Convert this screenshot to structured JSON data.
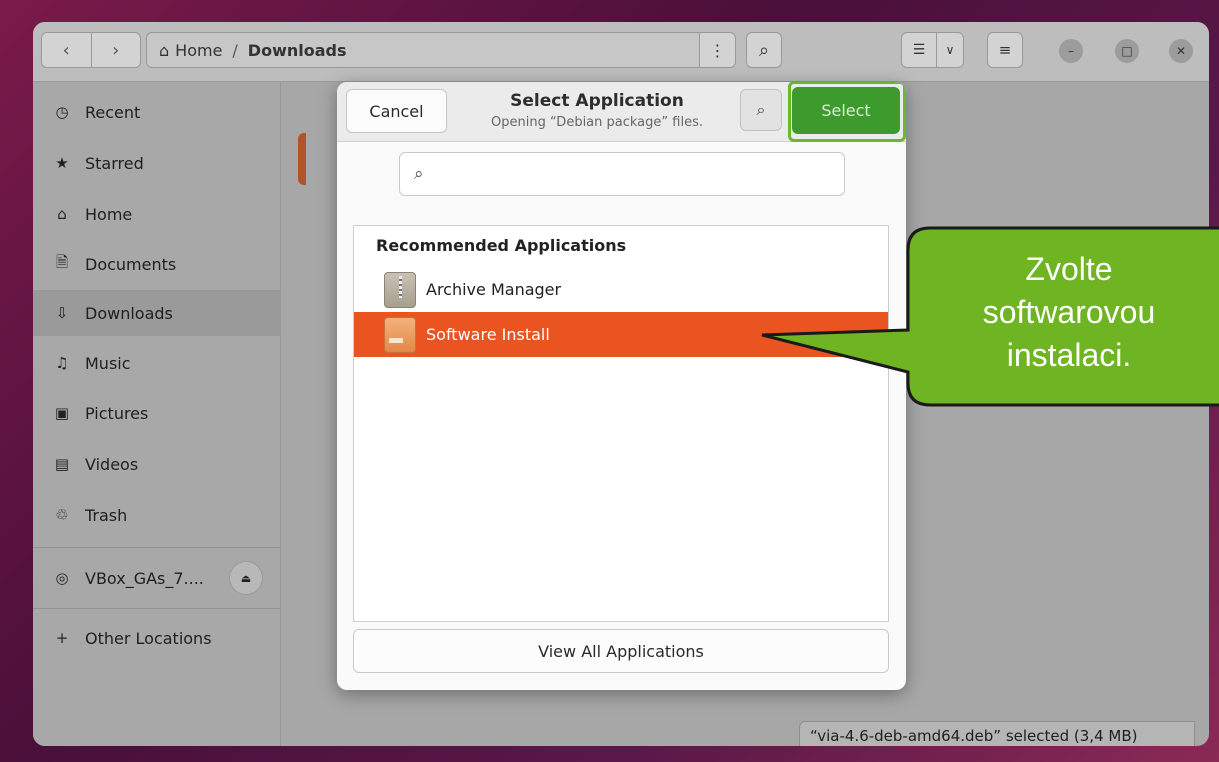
{
  "files_window": {
    "path": {
      "home_label": "Home",
      "separator": "/",
      "current": "Downloads"
    },
    "sidebar": {
      "items": [
        {
          "icon": "clock-icon",
          "label": "Recent"
        },
        {
          "icon": "star-icon",
          "label": "Starred"
        },
        {
          "icon": "home-icon",
          "label": "Home"
        },
        {
          "icon": "document-icon",
          "label": "Documents"
        },
        {
          "icon": "download-icon",
          "label": "Downloads",
          "active": true
        },
        {
          "icon": "music-icon",
          "label": "Music"
        },
        {
          "icon": "picture-icon",
          "label": "Pictures"
        },
        {
          "icon": "video-icon",
          "label": "Videos"
        },
        {
          "icon": "trash-icon",
          "label": "Trash"
        }
      ],
      "drive": {
        "icon": "disc-icon",
        "label": "VBox_GAs_7....",
        "eject_icon": "eject-icon"
      },
      "other": {
        "icon": "plus-icon",
        "label": "Other Locations"
      }
    },
    "status": "“via-4.6-deb-amd64.deb” selected  (3,4 MB)"
  },
  "dialog": {
    "cancel_label": "Cancel",
    "title": "Select Application",
    "subtitle": "Opening “Debian package” files.",
    "select_label": "Select",
    "search_placeholder": "",
    "list_heading": "Recommended Applications",
    "apps": [
      {
        "name": "Archive Manager",
        "icon": "archive-manager-icon",
        "selected": false
      },
      {
        "name": "Software Install",
        "icon": "software-install-icon",
        "selected": true
      }
    ],
    "view_all_label": "View All Applications"
  },
  "callout": {
    "lines": [
      "Zvolte",
      "softwarovou",
      "instalaci."
    ],
    "color": "#6fb423"
  },
  "colors": {
    "accent": "#e95420",
    "select_green": "#3d9b2e"
  }
}
